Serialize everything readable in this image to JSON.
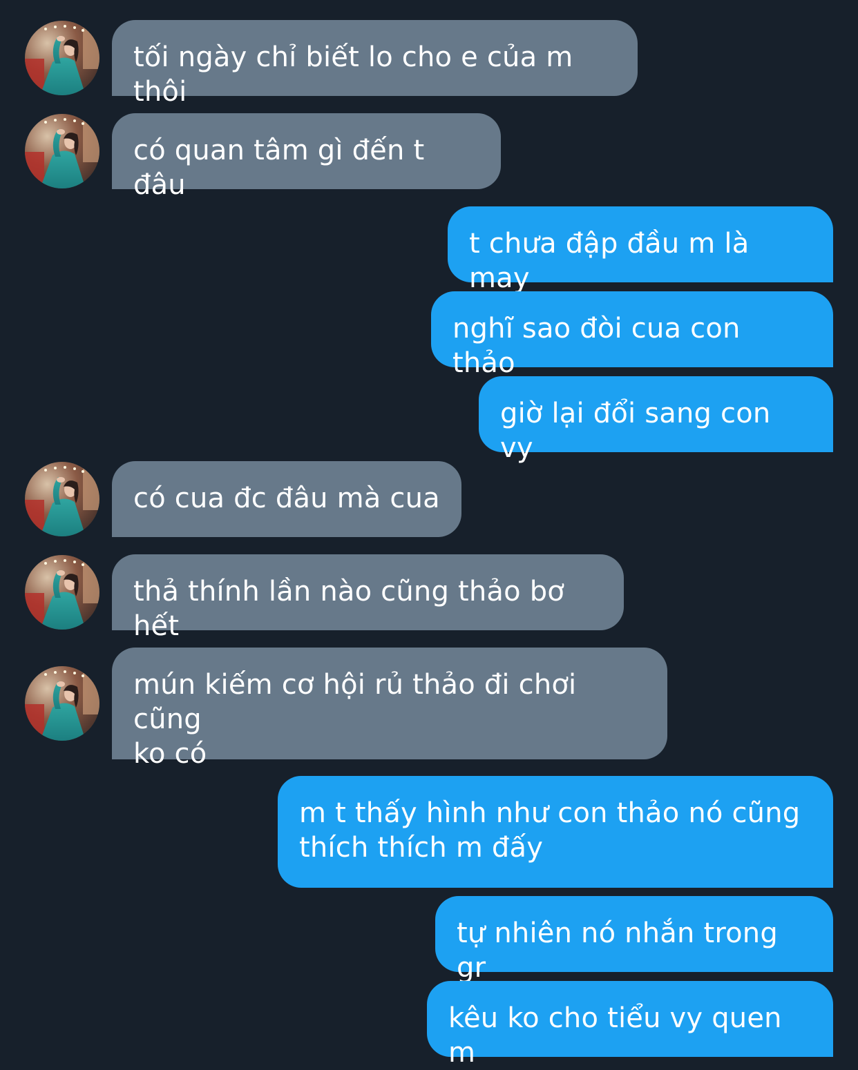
{
  "colors": {
    "background": "#17202b",
    "incoming_bubble": "#67798a",
    "outgoing_bubble": "#1da1f2",
    "text": "#ffffff"
  },
  "conversation": {
    "messages": [
      {
        "direction": "incoming",
        "text": "tối ngày chỉ biết lo cho e của m thôi",
        "avatar": "profile-photo-woman-teal-dress"
      },
      {
        "direction": "incoming",
        "text": "có quan tâm gì đến t đâu",
        "avatar": "profile-photo-woman-teal-dress"
      },
      {
        "direction": "outgoing",
        "text": "t chưa đập đầu m là may"
      },
      {
        "direction": "outgoing",
        "text": "nghĩ sao đòi cua con thảo"
      },
      {
        "direction": "outgoing",
        "text": "giờ lại đổi sang con vy"
      },
      {
        "direction": "incoming",
        "text": "có cua đc đâu mà cua",
        "avatar": "profile-photo-woman-teal-dress"
      },
      {
        "direction": "incoming",
        "text": "thả thính lần nào cũng thảo bơ hết",
        "avatar": "profile-photo-woman-teal-dress"
      },
      {
        "direction": "incoming",
        "text": "mún kiếm cơ hội rủ thảo đi chơi  cũng\nko có",
        "avatar": "profile-photo-woman-teal-dress"
      },
      {
        "direction": "outgoing",
        "text": "m t thấy hình như con thảo nó cũng\nthích thích m đấy"
      },
      {
        "direction": "outgoing",
        "text": "tự nhiên nó nhắn trong gr"
      },
      {
        "direction": "outgoing",
        "text": "kêu ko cho tiểu vy quen m"
      }
    ]
  }
}
